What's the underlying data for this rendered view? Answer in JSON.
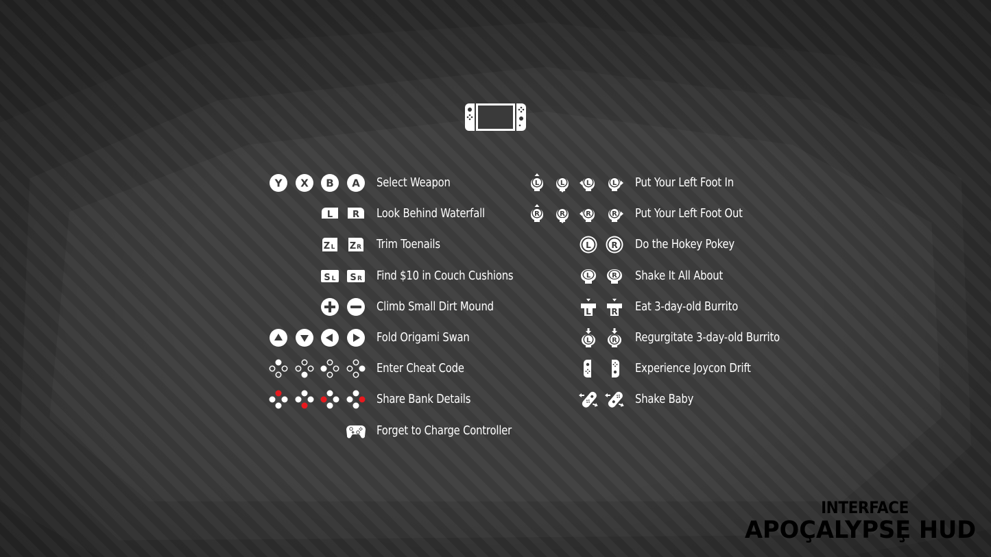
{
  "platform_icon": "nintendo-switch-console-icon",
  "colors": {
    "icon_fill": "#ffffff",
    "highlight_red": "#e8191e",
    "background": "#2a2a2a"
  },
  "left_column": [
    {
      "icons": [
        "y-button-icon",
        "x-button-icon",
        "b-button-icon",
        "a-button-icon"
      ],
      "glyphs": [
        "Y",
        "X",
        "B",
        "A"
      ],
      "label": "Select Weapon"
    },
    {
      "icons": [
        "l-bumper-icon",
        "r-bumper-icon"
      ],
      "glyphs": [
        "L",
        "R"
      ],
      "label": "Look Behind Waterfall"
    },
    {
      "icons": [
        "zl-trigger-icon",
        "zr-trigger-icon"
      ],
      "glyphs": [
        "ZL",
        "ZR"
      ],
      "label": "Trim Toenails"
    },
    {
      "icons": [
        "sl-button-icon",
        "sr-button-icon"
      ],
      "glyphs": [
        "SL",
        "SR"
      ],
      "label": "Find $10 in Couch Cushions"
    },
    {
      "icons": [
        "plus-button-icon",
        "minus-button-icon"
      ],
      "glyphs": [
        "+",
        "−"
      ],
      "label": "Climb Small Dirt Mound"
    },
    {
      "icons": [
        "dpad-up-icon",
        "dpad-down-icon",
        "dpad-left-icon",
        "dpad-right-icon"
      ],
      "glyphs": [
        "▲",
        "▼",
        "◀",
        "▶"
      ],
      "label": "Fold Origami Swan"
    },
    {
      "icons": [
        "face-top-icon",
        "face-bottom-icon",
        "face-left-icon",
        "face-right-icon"
      ],
      "glyphs": [
        "top",
        "bottom",
        "left",
        "right"
      ],
      "label": "Enter Cheat Code"
    },
    {
      "icons": [
        "face-top-red-icon",
        "face-bottom-red-icon",
        "face-left-red-icon",
        "face-right-red-icon"
      ],
      "glyphs": [
        "top",
        "bottom",
        "left",
        "right"
      ],
      "label": "Share Bank Details"
    },
    {
      "icons": [
        "pro-controller-icon"
      ],
      "glyphs": [
        ""
      ],
      "label": "Forget to Charge Controller"
    }
  ],
  "right_column": [
    {
      "icons": [
        "left-stick-up-icon",
        "left-stick-down-icon",
        "left-stick-left-icon",
        "left-stick-right-icon"
      ],
      "glyphs": [
        "L",
        "L",
        "L",
        "L"
      ],
      "label": "Put Your Left Foot In"
    },
    {
      "icons": [
        "right-stick-up-icon",
        "right-stick-down-icon",
        "right-stick-left-icon",
        "right-stick-right-icon"
      ],
      "glyphs": [
        "R",
        "R",
        "R",
        "R"
      ],
      "label": "Put Your Left Foot Out"
    },
    {
      "icons": [
        "left-stick-icon",
        "right-stick-icon"
      ],
      "glyphs": [
        "L",
        "R"
      ],
      "label": "Do the Hokey Pokey"
    },
    {
      "icons": [
        "left-stick-rotate-icon",
        "right-stick-rotate-icon"
      ],
      "glyphs": [
        "L",
        "R"
      ],
      "label": "Shake It All About"
    },
    {
      "icons": [
        "left-stick-press-icon",
        "right-stick-press-icon"
      ],
      "glyphs": [
        "L",
        "R"
      ],
      "label": "Eat 3-day-old Burrito"
    },
    {
      "icons": [
        "left-stick-click-icon",
        "right-stick-click-icon"
      ],
      "glyphs": [
        "L",
        "R"
      ],
      "label": "Regurgitate 3-day-old Burrito"
    },
    {
      "icons": [
        "left-joycon-icon",
        "right-joycon-icon"
      ],
      "glyphs": [
        "",
        ""
      ],
      "label": "Experience Joycon Drift"
    },
    {
      "icons": [
        "left-joycon-shake-icon",
        "right-joycon-shake-icon"
      ],
      "glyphs": [
        "",
        ""
      ],
      "label": "Shake Baby"
    }
  ],
  "branding": {
    "top": "INTERFACE",
    "main": "APOÇALYPSȨ HUD"
  }
}
